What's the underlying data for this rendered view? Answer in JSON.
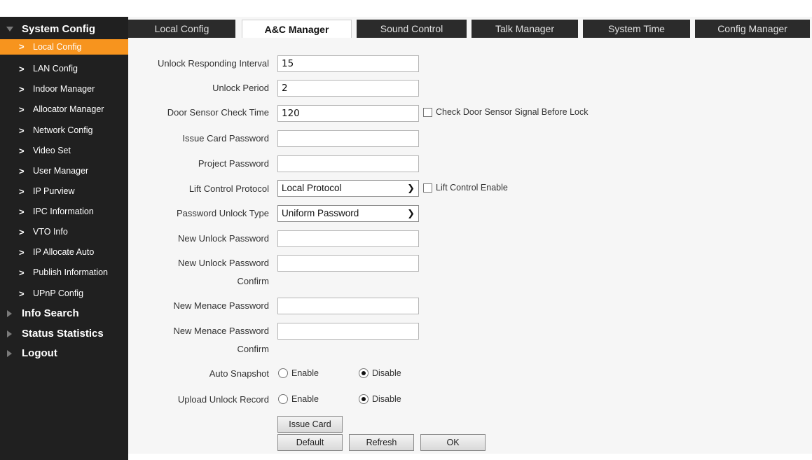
{
  "sidebar": {
    "system_config": "System Config",
    "items": [
      {
        "label": "Local Config"
      },
      {
        "label": "LAN Config"
      },
      {
        "label": "Indoor Manager"
      },
      {
        "label": "Allocator Manager"
      },
      {
        "label": "Network Config"
      },
      {
        "label": "Video Set"
      },
      {
        "label": "User Manager"
      },
      {
        "label": "IP Purview"
      },
      {
        "label": "IPC Information"
      },
      {
        "label": "VTO Info"
      },
      {
        "label": "IP Allocate Auto"
      },
      {
        "label": "Publish Information"
      },
      {
        "label": "UPnP Config"
      }
    ],
    "info_search": "Info Search",
    "status_statistics": "Status Statistics",
    "logout": "Logout",
    "active_color": "#f7941e"
  },
  "tabs": [
    {
      "label": "Local Config"
    },
    {
      "label": "A&C Manager"
    },
    {
      "label": "Sound Control"
    },
    {
      "label": "Talk Manager"
    },
    {
      "label": "System Time"
    },
    {
      "label": "Config Manager"
    }
  ],
  "form": {
    "unlock_interval_label": "Unlock Responding Interval",
    "unlock_interval_value": "15",
    "unlock_period_label": "Unlock Period",
    "unlock_period_value": "2",
    "door_sensor_label": "Door Sensor Check Time",
    "door_sensor_value": "120",
    "door_sensor_check_label": "Check Door Sensor Signal Before Lock",
    "issue_card_pwd_label": "Issue Card Password",
    "issue_card_pwd_value": "",
    "project_pwd_label": "Project Password",
    "project_pwd_value": "",
    "lift_protocol_label": "Lift Control Protocol",
    "lift_protocol_value": "Local Protocol",
    "lift_enable_label": "Lift Control Enable",
    "pwd_unlock_type_label": "Password Unlock Type",
    "pwd_unlock_type_value": "Uniform Password",
    "new_unlock_pwd_label": "New Unlock Password",
    "new_unlock_pwd_value": "",
    "new_unlock_pwd_confirm_label_1": "New Unlock Password",
    "new_unlock_pwd_confirm_label_2": "Confirm",
    "new_unlock_pwd_confirm_value": "",
    "new_menace_pwd_label": "New Menace Password",
    "new_menace_pwd_value": "",
    "new_menace_pwd_confirm_label_1": "New Menace Password",
    "new_menace_pwd_confirm_label_2": "Confirm",
    "new_menace_pwd_confirm_value": "",
    "auto_snapshot_label": "Auto Snapshot",
    "upload_unlock_label": "Upload Unlock Record",
    "enable_label": "Enable",
    "disable_label": "Disable",
    "auto_snapshot_selected": "Disable",
    "upload_unlock_selected": "Disable"
  },
  "buttons": {
    "issue_card": "Issue Card",
    "default": "Default",
    "refresh": "Refresh",
    "ok": "OK"
  }
}
